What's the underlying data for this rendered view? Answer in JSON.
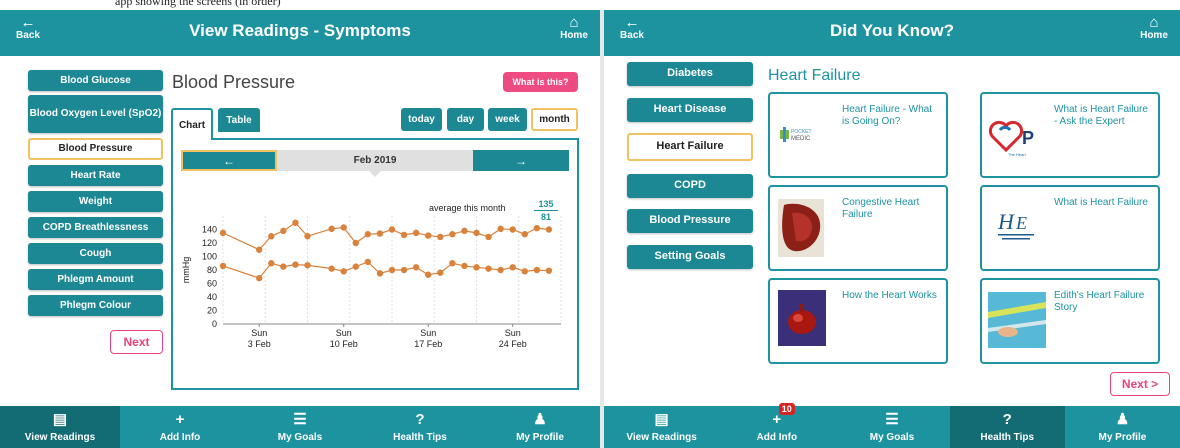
{
  "caption": "app showing the screens (in order)",
  "left": {
    "topbar": {
      "back_label": "Back",
      "title": "View Readings - Symptoms",
      "home_label": "Home"
    },
    "sidebar": [
      {
        "label": "Blood Glucose",
        "active": false
      },
      {
        "label": "Blood Oxygen Level (SpO2)",
        "active": false
      },
      {
        "label": "Blood Pressure",
        "active": true
      },
      {
        "label": "Heart Rate",
        "active": false
      },
      {
        "label": "Weight",
        "active": false
      },
      {
        "label": "COPD Breathlessness",
        "active": false
      },
      {
        "label": "Cough",
        "active": false
      },
      {
        "label": "Phlegm Amount",
        "active": false
      },
      {
        "label": "Phlegm Colour",
        "active": false
      }
    ],
    "next_label": "Next",
    "heading": "Blood Pressure",
    "what_is_this": "What is this?",
    "tabs": {
      "chart": "Chart",
      "table": "Table"
    },
    "ranges": {
      "today": "today",
      "day": "day",
      "week": "week",
      "month": "month",
      "selected": "month"
    },
    "month_label": "Feb 2019",
    "average_label": "average this month",
    "average_systolic": "135",
    "average_diastolic": "81"
  },
  "chart_data": {
    "type": "line",
    "ylabel": "mmHg",
    "ylim": [
      0,
      160
    ],
    "yticks": [
      0,
      20,
      40,
      60,
      80,
      100,
      120,
      140
    ],
    "xlim": [
      0,
      28
    ],
    "xticks": [
      {
        "day": 3,
        "label1": "Sun",
        "label2": "3 Feb"
      },
      {
        "day": 10,
        "label1": "Sun",
        "label2": "10 Feb"
      },
      {
        "day": 17,
        "label1": "Sun",
        "label2": "17 Feb"
      },
      {
        "day": 24,
        "label1": "Sun",
        "label2": "24 Feb"
      }
    ],
    "color": "#d9823b",
    "series": [
      {
        "x": [
          0,
          3,
          4,
          5,
          6,
          7,
          9,
          10,
          11,
          12,
          13,
          14,
          15,
          16,
          17,
          18,
          19,
          20,
          21,
          22,
          23,
          24,
          25,
          26,
          27
        ],
        "values": [
          135,
          110,
          130,
          138,
          150,
          130,
          141,
          143,
          120,
          133,
          134,
          140,
          132,
          135,
          131,
          129,
          133,
          138,
          135,
          129,
          141,
          140,
          133,
          142,
          140
        ]
      },
      {
        "x": [
          0,
          3,
          4,
          5,
          6,
          7,
          9,
          10,
          11,
          12,
          13,
          14,
          15,
          16,
          17,
          18,
          19,
          20,
          21,
          22,
          23,
          24,
          25,
          26,
          27
        ],
        "values": [
          86,
          68,
          90,
          85,
          88,
          87,
          82,
          78,
          85,
          92,
          75,
          80,
          80,
          84,
          73,
          76,
          90,
          86,
          84,
          82,
          80,
          84,
          78,
          80,
          79
        ]
      }
    ]
  },
  "right": {
    "topbar": {
      "back_label": "Back",
      "title": "Did You Know?",
      "home_label": "Home"
    },
    "sidebar": [
      {
        "label": "Diabetes",
        "active": false
      },
      {
        "label": "Heart Disease",
        "active": false
      },
      {
        "label": "Heart Failure",
        "active": true
      },
      {
        "label": "COPD",
        "active": false
      },
      {
        "label": "Blood Pressure",
        "active": false
      },
      {
        "label": "Setting Goals",
        "active": false
      }
    ],
    "heading": "Heart Failure",
    "cards": [
      {
        "title": "Heart Failure - What is Going On?",
        "thumb": "pocket-medic-logo"
      },
      {
        "title": "What is Heart Failure - Ask the Expert",
        "thumb": "heart-foundation-logo"
      },
      {
        "title": "Congestive Heart Failure",
        "thumb": "heart-tissue-image"
      },
      {
        "title": "What is Heart Failure",
        "thumb": "hse-logo"
      },
      {
        "title": "How the Heart Works",
        "thumb": "heart-model-image"
      },
      {
        "title": "Edith's Heart Failure Story",
        "thumb": "swimming-image"
      }
    ],
    "next_label": "Next >"
  },
  "bottom_nav": {
    "items": [
      {
        "label": "View Readings",
        "icon": "readings-icon"
      },
      {
        "label": "Add Info",
        "icon": "plus-icon"
      },
      {
        "label": "My Goals",
        "icon": "list-icon"
      },
      {
        "label": "Health Tips",
        "icon": "question-icon"
      },
      {
        "label": "My Profile",
        "icon": "person-icon"
      }
    ],
    "left_active": "View Readings",
    "right_active": "Health Tips",
    "right_badge": "10"
  }
}
